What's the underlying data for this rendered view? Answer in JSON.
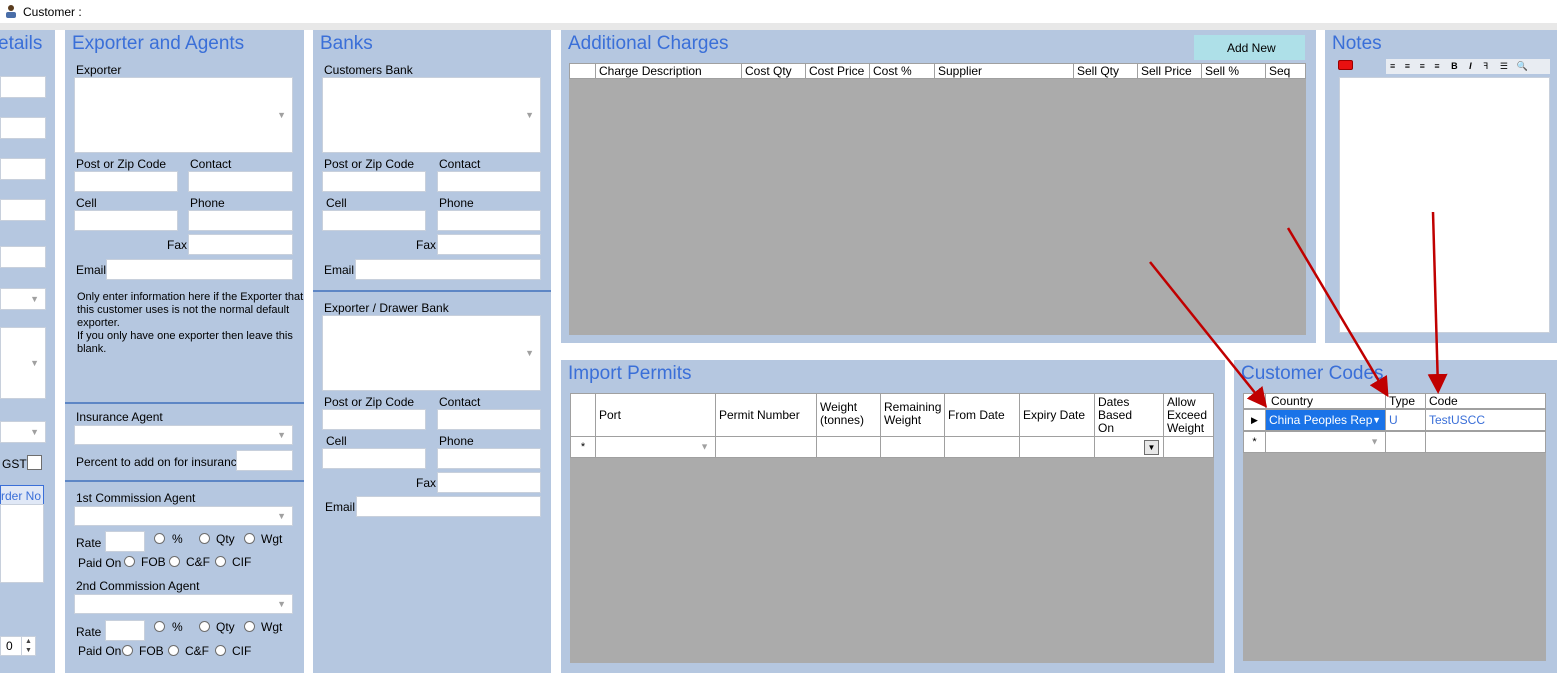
{
  "window": {
    "title": "Customer :"
  },
  "details": {
    "title": "etails",
    "gst_label": "GST",
    "order_no_label": "rder No",
    "spinner_value": "0"
  },
  "exporter_agents": {
    "title": "Exporter and Agents",
    "exporter_label": "Exporter",
    "post_zip_label": "Post or Zip Code",
    "contact_label": "Contact",
    "cell_label": "Cell",
    "phone_label": "Phone",
    "fax_label": "Fax",
    "email_label": "Email",
    "info_text_1": "Only enter information here if the Exporter that",
    "info_text_2": "this customer uses is not the normal default",
    "info_text_3": "exporter.",
    "info_text_4": "If you only have one exporter then leave this",
    "info_text_5": "blank.",
    "insurance_agent_label": "Insurance Agent",
    "percent_label": "Percent to add on for insurance",
    "commission1_label": "1st Commission Agent",
    "commission2_label": "2nd Commission Agent",
    "rate_label": "Rate",
    "pct_label": "%",
    "qty_label": "Qty",
    "wgt_label": "Wgt",
    "paid_on_label": "Paid On",
    "fob_label": "FOB",
    "cf_label": "C&F",
    "cif_label": "CIF"
  },
  "banks": {
    "title": "Banks",
    "customers_bank_label": "Customers Bank",
    "post_zip_label": "Post or Zip Code",
    "contact_label": "Contact",
    "cell_label": "Cell",
    "phone_label": "Phone",
    "fax_label": "Fax",
    "email_label": "Email",
    "exporter_bank_label": "Exporter / Drawer Bank"
  },
  "additional_charges": {
    "title": "Additional Charges",
    "add_new_label": "Add New",
    "columns": [
      "Charge Description",
      "Cost Qty",
      "Cost Price",
      "Cost %",
      "Supplier",
      "Sell Qty",
      "Sell Price",
      "Sell %",
      "Seq"
    ]
  },
  "notes": {
    "title": "Notes"
  },
  "import_permits": {
    "title": "Import Permits",
    "col_port": "Port",
    "col_permit": "Permit Number",
    "col_weight_1": "Weight",
    "col_weight_2": "(tonnes)",
    "col_rem_1": "Remaining",
    "col_rem_2": "Weight",
    "col_from": "From Date",
    "col_expiry": "Expiry Date",
    "col_dates_1": "Dates",
    "col_dates_2": "Based",
    "col_dates_3": "On",
    "col_allow_1": "Allow",
    "col_allow_2": "Exceed",
    "col_allow_3": "Weight",
    "new_row_marker": "*"
  },
  "customer_codes": {
    "title": "Customer Codes",
    "col_country": "Country",
    "col_type": "Type",
    "col_code": "Code",
    "row_country": "China Peoples Rep",
    "row_type": "U",
    "row_code": "TestUSCC",
    "new_row_marker": "*"
  },
  "colors": {
    "panel": "#b5c7e0",
    "title": "#3a6fd8",
    "grid": "#ababab",
    "arrow": "#c00000",
    "selection": "#1a73e8"
  }
}
